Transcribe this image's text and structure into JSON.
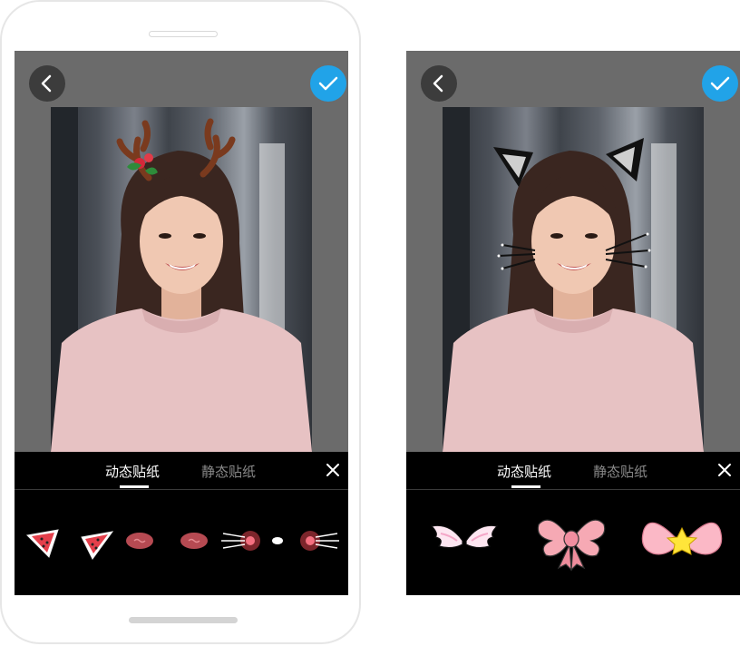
{
  "screens": [
    {
      "id": "left",
      "face_sticker": "reindeer-antlers",
      "tabs": [
        {
          "label": "动态贴纸",
          "active": true
        },
        {
          "label": "静态贴纸",
          "active": false
        }
      ],
      "stickers": [
        "watermelon-ear-left",
        "watermelon-ear-right",
        "blush-cheek",
        "blush-cheek",
        "whisker-blush-left",
        "nose-dot",
        "whisker-blush-right"
      ]
    },
    {
      "id": "right",
      "face_sticker": "cat-ears-whiskers",
      "tabs": [
        {
          "label": "动态贴纸",
          "active": true
        },
        {
          "label": "静态贴纸",
          "active": false
        }
      ],
      "stickers": [
        "angel-wings",
        "pink-bow",
        "pink-bow-star"
      ]
    }
  ],
  "icons": {
    "back": "chevron-left-icon",
    "confirm": "checkmark-icon",
    "close": "close-icon"
  },
  "colors": {
    "accent": "#21a3e8",
    "toolbar_bg": "#3c3c3c",
    "screen_bg": "#6b6b6b",
    "panel_bg": "#000000"
  }
}
